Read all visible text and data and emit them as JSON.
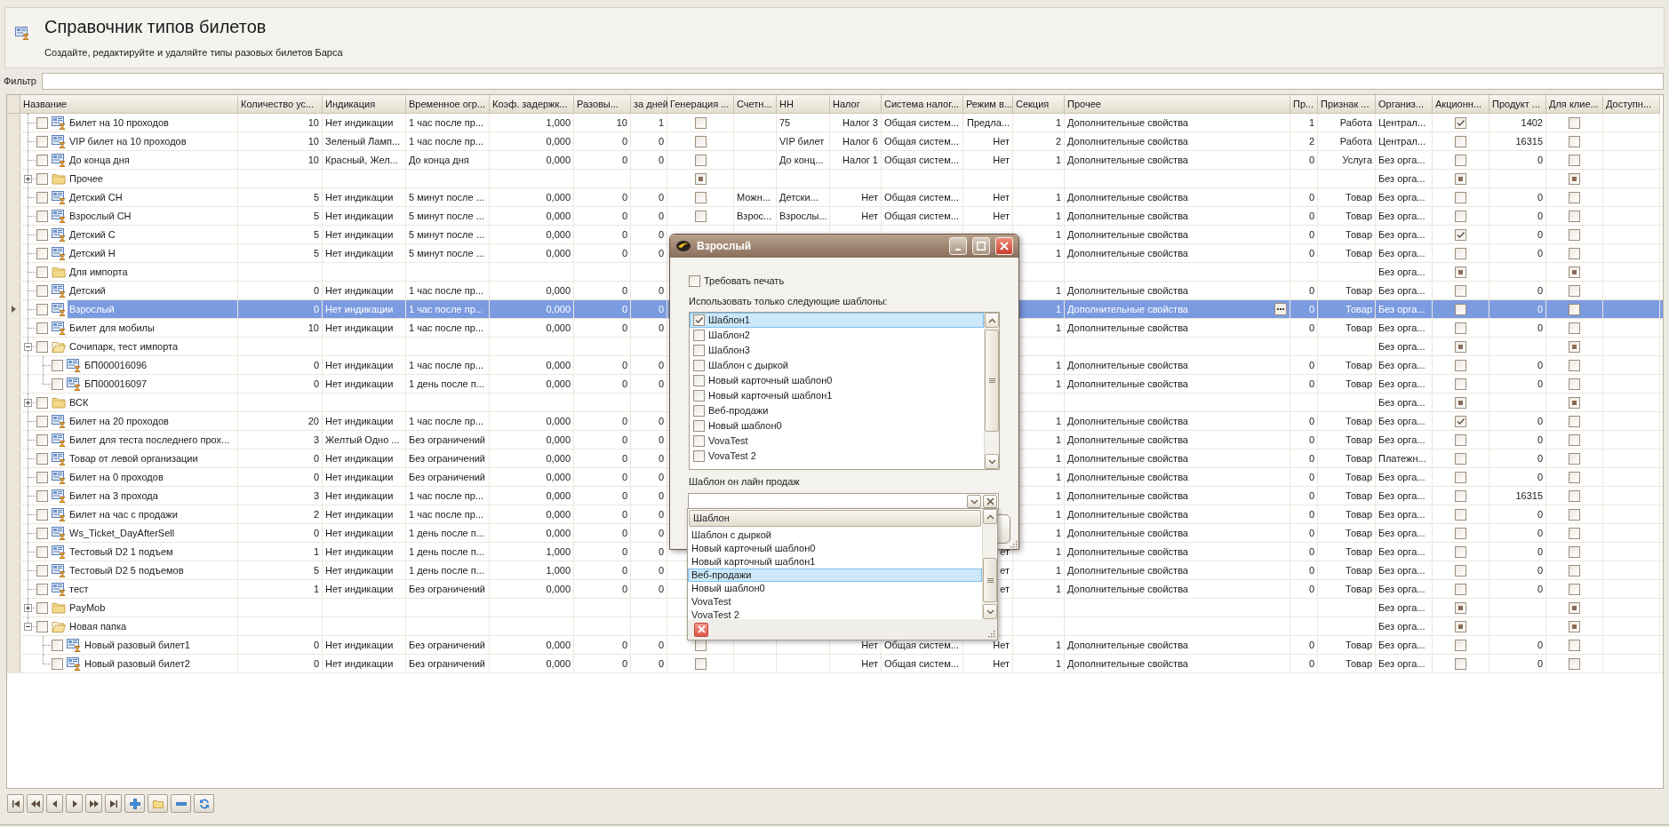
{
  "header": {
    "title": "Справочник типов билетов",
    "subtitle": "Создайте, редактируйте и удаляйте типы разовых билетов Барса"
  },
  "filter": {
    "label": "Фильтр"
  },
  "table": {
    "columns": [
      {
        "label": "Название",
        "kind": "tree"
      },
      {
        "label": "Количество ус...",
        "kind": "text"
      },
      {
        "label": "Индикация",
        "kind": "text"
      },
      {
        "label": "Временное огр...",
        "kind": "text"
      },
      {
        "label": "Коэф. задержк...",
        "kind": "text"
      },
      {
        "label": "Разовы...",
        "kind": "text"
      },
      {
        "label": "за дней",
        "kind": "text"
      },
      {
        "label": "Генерация ...",
        "kind": "check"
      },
      {
        "label": "Счетн...",
        "kind": "text"
      },
      {
        "label": "НН",
        "kind": "text"
      },
      {
        "label": "Налог",
        "kind": "text"
      },
      {
        "label": "Система налог...",
        "kind": "text"
      },
      {
        "label": "Режим в...",
        "kind": "text"
      },
      {
        "label": "Секция",
        "kind": "text"
      },
      {
        "label": "Прочее",
        "kind": "details"
      },
      {
        "label": "Пр...",
        "kind": "text"
      },
      {
        "label": "Признак ...",
        "kind": "text"
      },
      {
        "label": "Организ...",
        "kind": "text"
      },
      {
        "label": "Акционн...",
        "kind": "check"
      },
      {
        "label": "Продукт ...",
        "kind": "text"
      },
      {
        "label": "Для клие...",
        "kind": "check"
      },
      {
        "label": "Доступн...",
        "kind": "text"
      }
    ],
    "rows": [
      {
        "kind": "ticket",
        "checked": false,
        "selected": false,
        "cells": [
          "Билет на 10 проходов",
          "10",
          "Нет индикации",
          "1 час после пр...",
          "1,000",
          "10",
          "1",
          {
            "checked": false
          },
          null,
          "75",
          "Налог 3",
          "Общая систем...",
          "Предла...",
          "1",
          "Дополнительные свойства",
          "1",
          "Работа",
          "Централ...",
          {
            "checked": true
          },
          "1402",
          {
            "checked": false
          },
          null
        ]
      },
      {
        "kind": "ticket",
        "checked": false,
        "selected": false,
        "cells": [
          "VIP билет на 10 проходов",
          "10",
          "Зеленый Ламп...",
          "1 час после пр...",
          "0,000",
          "0",
          "0",
          {
            "checked": false
          },
          null,
          "VIP билет",
          "Налог 6",
          "Общая систем...",
          "Нет",
          "2",
          "Дополнительные свойства",
          "2",
          "Работа",
          "Централ...",
          {
            "checked": false
          },
          "16315",
          {
            "checked": false
          },
          null
        ]
      },
      {
        "kind": "ticket",
        "checked": false,
        "selected": false,
        "cells": [
          "До конца дня",
          "10",
          "Красный, Жел...",
          "До конца дня",
          "0,000",
          "0",
          "0",
          {
            "checked": false
          },
          null,
          "До конц...",
          "Налог 1",
          "Общая систем...",
          "Нет",
          "1",
          "Дополнительные свойства",
          "0",
          "Услуга",
          "Без орга...",
          {
            "checked": false
          },
          "0",
          {
            "checked": false
          },
          null
        ]
      },
      {
        "kind": "folder",
        "checked": false,
        "selected": false,
        "expanded": false,
        "cells": [
          "Прочее",
          null,
          null,
          null,
          null,
          null,
          null,
          {
            "indeterminate": true
          },
          null,
          null,
          null,
          null,
          null,
          null,
          null,
          null,
          null,
          "Без орга...",
          {
            "indeterminate": true
          },
          null,
          {
            "indeterminate": true
          },
          null
        ]
      },
      {
        "kind": "ticket",
        "checked": false,
        "selected": false,
        "cells": [
          "Детский СН",
          "5",
          "Нет индикации",
          "5 минут после ...",
          "0,000",
          "0",
          "0",
          {
            "checked": false
          },
          "Можн...",
          "Детски...",
          "Нет",
          "Общая систем...",
          "Нет",
          "1",
          "Дополнительные свойства",
          "0",
          "Товар",
          "Без орга...",
          {
            "checked": false
          },
          "0",
          {
            "checked": false
          },
          null
        ]
      },
      {
        "kind": "ticket",
        "checked": false,
        "selected": false,
        "cells": [
          "Взрослый СН",
          "5",
          "Нет индикации",
          "5 минут после ...",
          "0,000",
          "0",
          "0",
          {
            "checked": false
          },
          "Взрос...",
          "Взрослы...",
          "Нет",
          "Общая систем...",
          "Нет",
          "1",
          "Дополнительные свойства",
          "0",
          "Товар",
          "Без орга...",
          {
            "checked": false
          },
          "0",
          {
            "checked": false
          },
          null
        ]
      },
      {
        "kind": "ticket",
        "checked": false,
        "selected": false,
        "cells": [
          "Детский С",
          "5",
          "Нет индикации",
          "5 минут после ...",
          "0,000",
          "0",
          "0",
          null,
          null,
          null,
          null,
          null,
          null,
          "1",
          "Дополнительные свойства",
          "0",
          "Товар",
          "Без орга...",
          {
            "checked": true
          },
          "0",
          {
            "checked": false
          },
          null
        ]
      },
      {
        "kind": "ticket",
        "checked": false,
        "selected": false,
        "cells": [
          "Детский Н",
          "5",
          "Нет индикации",
          "5 минут после ...",
          "0,000",
          "0",
          "0",
          null,
          null,
          null,
          null,
          null,
          null,
          "1",
          "Дополнительные свойства",
          "0",
          "Товар",
          "Без орга...",
          {
            "checked": false
          },
          "0",
          {
            "checked": false
          },
          null
        ]
      },
      {
        "kind": "folder",
        "checked": false,
        "selected": false,
        "cells": [
          "Для импорта",
          null,
          null,
          null,
          null,
          null,
          null,
          null,
          null,
          null,
          null,
          null,
          null,
          null,
          null,
          null,
          null,
          "Без орга...",
          {
            "indeterminate": true
          },
          null,
          {
            "indeterminate": true
          },
          null
        ]
      },
      {
        "kind": "ticket",
        "checked": false,
        "selected": false,
        "cells": [
          "Детский",
          "0",
          "Нет индикации",
          "1 час после пр...",
          "0,000",
          "0",
          "0",
          null,
          null,
          null,
          null,
          null,
          null,
          "1",
          "Дополнительные свойства",
          "0",
          "Товар",
          "Без орга...",
          {
            "checked": false
          },
          "0",
          {
            "checked": false
          },
          null
        ]
      },
      {
        "kind": "ticket",
        "checked": false,
        "selected": true,
        "cells": [
          "Взрослый",
          "0",
          "Нет индикации",
          "1 час после пр...",
          "0,000",
          "0",
          "0",
          null,
          null,
          null,
          null,
          null,
          null,
          "1",
          "Дополнительные свойства",
          "0",
          "Товар",
          "Без орга...",
          {
            "checked": false
          },
          "0",
          {
            "checked": false
          },
          null
        ]
      },
      {
        "kind": "ticket",
        "checked": false,
        "selected": false,
        "cells": [
          "Билет для мобилы",
          "10",
          "Нет индикации",
          "1 час после пр...",
          "0,000",
          "0",
          "0",
          null,
          null,
          null,
          null,
          null,
          null,
          "1",
          "Дополнительные свойства",
          "0",
          "Товар",
          "Без орга...",
          {
            "checked": false
          },
          "0",
          {
            "checked": false
          },
          null
        ]
      },
      {
        "kind": "folder",
        "checked": false,
        "selected": false,
        "expanded": true,
        "cells": [
          "Сочипарк, тест импорта",
          null,
          null,
          null,
          null,
          null,
          null,
          null,
          null,
          null,
          null,
          null,
          null,
          null,
          null,
          null,
          null,
          "Без орга...",
          {
            "indeterminate": true
          },
          null,
          {
            "indeterminate": true
          },
          null
        ],
        "children": [
          {
            "kind": "ticket",
            "checked": false,
            "selected": false,
            "cells": [
              "БП000016096",
              "0",
              "Нет индикации",
              "1 час после пр...",
              "0,000",
              "0",
              "0",
              null,
              null,
              null,
              null,
              null,
              null,
              "1",
              "Дополнительные свойства",
              "0",
              "Товар",
              "Без орга...",
              {
                "checked": false
              },
              "0",
              {
                "checked": false
              },
              null
            ]
          },
          {
            "kind": "ticket",
            "checked": false,
            "selected": false,
            "cells": [
              "БП000016097",
              "0",
              "Нет индикации",
              "1 день после п...",
              "0,000",
              "0",
              "0",
              null,
              null,
              null,
              null,
              null,
              null,
              "1",
              "Дополнительные свойства",
              "0",
              "Товар",
              "Без орга...",
              {
                "checked": false
              },
              "0",
              {
                "checked": false
              },
              null
            ]
          }
        ]
      },
      {
        "kind": "folder",
        "checked": false,
        "selected": false,
        "expanded": false,
        "cells": [
          "ВСК",
          null,
          null,
          null,
          null,
          null,
          null,
          null,
          null,
          null,
          null,
          null,
          null,
          null,
          null,
          null,
          null,
          "Без орга...",
          {
            "indeterminate": true
          },
          null,
          {
            "indeterminate": true
          },
          null
        ]
      },
      {
        "kind": "ticket",
        "checked": false,
        "selected": false,
        "cells": [
          "Билет на 20 проходов",
          "20",
          "Нет индикации",
          "1 час после пр...",
          "0,000",
          "0",
          "0",
          null,
          null,
          null,
          null,
          null,
          null,
          "1",
          "Дополнительные свойства",
          "0",
          "Товар",
          "Без орга...",
          {
            "checked": true
          },
          "0",
          {
            "checked": false
          },
          null
        ]
      },
      {
        "kind": "ticket",
        "checked": false,
        "selected": false,
        "cells": [
          "Билет для теста последнего прох...",
          "3",
          "Желтый Одно ...",
          "Без ограничений",
          "0,000",
          "0",
          "0",
          null,
          null,
          null,
          null,
          null,
          null,
          "1",
          "Дополнительные свойства",
          "0",
          "Товар",
          "Без орга...",
          {
            "checked": false
          },
          "0",
          {
            "checked": false
          },
          null
        ]
      },
      {
        "kind": "ticket",
        "checked": false,
        "selected": false,
        "cells": [
          "Товар от левой организации",
          "0",
          "Нет индикации",
          "Без ограничений",
          "0,000",
          "0",
          "0",
          null,
          null,
          null,
          null,
          null,
          null,
          "1",
          "Дополнительные свойства",
          "0",
          "Товар",
          "Платежн...",
          {
            "checked": false
          },
          "0",
          {
            "checked": false
          },
          null
        ]
      },
      {
        "kind": "ticket",
        "checked": false,
        "selected": false,
        "cells": [
          "Билет на 0 проходов",
          "0",
          "Нет индикации",
          "Без ограничений",
          "0,000",
          "0",
          "0",
          null,
          null,
          null,
          null,
          null,
          null,
          "1",
          "Дополнительные свойства",
          "0",
          "Товар",
          "Без орга...",
          {
            "checked": false
          },
          "0",
          {
            "checked": false
          },
          null
        ]
      },
      {
        "kind": "ticket",
        "checked": false,
        "selected": false,
        "cells": [
          "Билет на 3 прохода",
          "3",
          "Нет индикации",
          "1 час после пр...",
          "0,000",
          "0",
          "0",
          null,
          null,
          null,
          null,
          null,
          null,
          "1",
          "Дополнительные свойства",
          "0",
          "Товар",
          "Без орга...",
          {
            "checked": false
          },
          "16315",
          {
            "checked": false
          },
          null
        ]
      },
      {
        "kind": "ticket",
        "checked": false,
        "selected": false,
        "cells": [
          "Билет на час с продажи",
          "2",
          "Нет индикации",
          "1 час после пр...",
          "0,000",
          "0",
          "0",
          null,
          null,
          null,
          null,
          null,
          null,
          "1",
          "Дополнительные свойства",
          "0",
          "Товар",
          "Без орга...",
          {
            "checked": false
          },
          "0",
          {
            "checked": false
          },
          null
        ]
      },
      {
        "kind": "ticket",
        "checked": false,
        "selected": false,
        "cells": [
          "Ws_Ticket_DayAfterSell",
          "0",
          "Нет индикации",
          "1 день после п...",
          "0,000",
          "0",
          "0",
          null,
          null,
          null,
          null,
          null,
          null,
          "1",
          "Дополнительные свойства",
          "0",
          "Товар",
          "Без орга...",
          {
            "checked": false
          },
          "0",
          {
            "checked": false
          },
          null
        ]
      },
      {
        "kind": "ticket",
        "checked": false,
        "selected": false,
        "cells": [
          "Тестовый D2 1 подъем",
          "1",
          "Нет индикации",
          "1 день после п...",
          "1,000",
          "0",
          "0",
          null,
          null,
          null,
          null,
          null,
          "ет",
          "1",
          "Дополнительные свойства",
          "0",
          "Товар",
          "Без орга...",
          {
            "checked": false
          },
          "0",
          {
            "checked": false
          },
          null
        ]
      },
      {
        "kind": "ticket",
        "checked": false,
        "selected": false,
        "cells": [
          "Тестовый D2 5 подъемов",
          "5",
          "Нет индикации",
          "1 день после п...",
          "1,000",
          "0",
          "0",
          null,
          null,
          null,
          null,
          null,
          "ет",
          "1",
          "Дополнительные свойства",
          "0",
          "Товар",
          "Без орга...",
          {
            "checked": false
          },
          "0",
          {
            "checked": false
          },
          null
        ]
      },
      {
        "kind": "ticket",
        "checked": false,
        "selected": false,
        "cells": [
          "тест",
          "1",
          "Нет индикации",
          "Без ограничений",
          "0,000",
          "0",
          "0",
          null,
          null,
          null,
          null,
          null,
          "ет",
          "1",
          "Дополнительные свойства",
          "0",
          "Товар",
          "Без орга...",
          {
            "checked": false
          },
          "0",
          {
            "checked": false
          },
          null
        ]
      },
      {
        "kind": "folder",
        "checked": false,
        "selected": false,
        "expanded": false,
        "cells": [
          "PayMob",
          null,
          null,
          null,
          null,
          null,
          null,
          null,
          null,
          null,
          null,
          null,
          null,
          null,
          null,
          null,
          null,
          "Без орга...",
          {
            "indeterminate": true
          },
          null,
          {
            "indeterminate": true
          },
          null
        ]
      },
      {
        "kind": "folder",
        "checked": false,
        "selected": false,
        "expanded": true,
        "cells": [
          "Новая папка",
          null,
          null,
          null,
          null,
          null,
          null,
          null,
          null,
          null,
          null,
          null,
          null,
          null,
          null,
          null,
          null,
          "Без орга...",
          {
            "indeterminate": true
          },
          null,
          {
            "indeterminate": true
          },
          null
        ],
        "children": [
          {
            "kind": "ticket",
            "checked": false,
            "selected": false,
            "cells": [
              "Новый разовый билет1",
              "0",
              "Нет индикации",
              "Без ограничений",
              "0,000",
              "0",
              "0",
              {
                "checked": false
              },
              null,
              null,
              "Нет",
              "Общая систем...",
              "Нет",
              "1",
              "Дополнительные свойства",
              "0",
              "Товар",
              "Без орга...",
              {
                "checked": false
              },
              "0",
              {
                "checked": false
              },
              null
            ]
          },
          {
            "kind": "ticket",
            "checked": false,
            "selected": false,
            "cells": [
              "Новый разовый билет2",
              "0",
              "Нет индикации",
              "Без ограничений",
              "0,000",
              "0",
              "0",
              {
                "checked": false
              },
              null,
              null,
              "Нет",
              "Общая систем...",
              "Нет",
              "1",
              "Дополнительные свойства",
              "0",
              "Товар",
              "Без орга...",
              {
                "checked": false
              },
              "0",
              {
                "checked": false
              },
              null
            ]
          }
        ]
      }
    ]
  },
  "dialog": {
    "title": "Взрослый",
    "require_print": {
      "label": "Требовать печать",
      "checked": false
    },
    "templates_label": "Использовать только следующие шаблоны:",
    "templates": [
      {
        "label": "Шаблон1",
        "checked": true,
        "selected": true
      },
      {
        "label": "Шаблон2",
        "checked": false,
        "selected": false
      },
      {
        "label": "Шаблон3",
        "checked": false,
        "selected": false
      },
      {
        "label": "Шаблон с дыркой",
        "checked": false,
        "selected": false
      },
      {
        "label": "Новый карточный шаблон0",
        "checked": false,
        "selected": false
      },
      {
        "label": "Новый карточный шаблон1",
        "checked": false,
        "selected": false
      },
      {
        "label": "Веб-продажи",
        "checked": false,
        "selected": false
      },
      {
        "label": "Новый шаблон0",
        "checked": false,
        "selected": false
      },
      {
        "label": "VovaTest",
        "checked": false,
        "selected": false
      },
      {
        "label": "VovaTest 2",
        "checked": false,
        "selected": false
      }
    ],
    "online_label": "Шаблон он лайн продаж",
    "dropdown": {
      "column": "Шаблон",
      "items": [
        {
          "label": "Шаблон с дыркой",
          "selected": false
        },
        {
          "label": "Новый карточный шаблон0",
          "selected": false
        },
        {
          "label": "Новый карточный шаблон1",
          "selected": false
        },
        {
          "label": "Веб-продажи",
          "selected": true
        },
        {
          "label": "Новый шаблон0",
          "selected": false
        },
        {
          "label": "VovaTest",
          "selected": false
        },
        {
          "label": "VovaTest 2",
          "selected": false
        }
      ]
    }
  }
}
